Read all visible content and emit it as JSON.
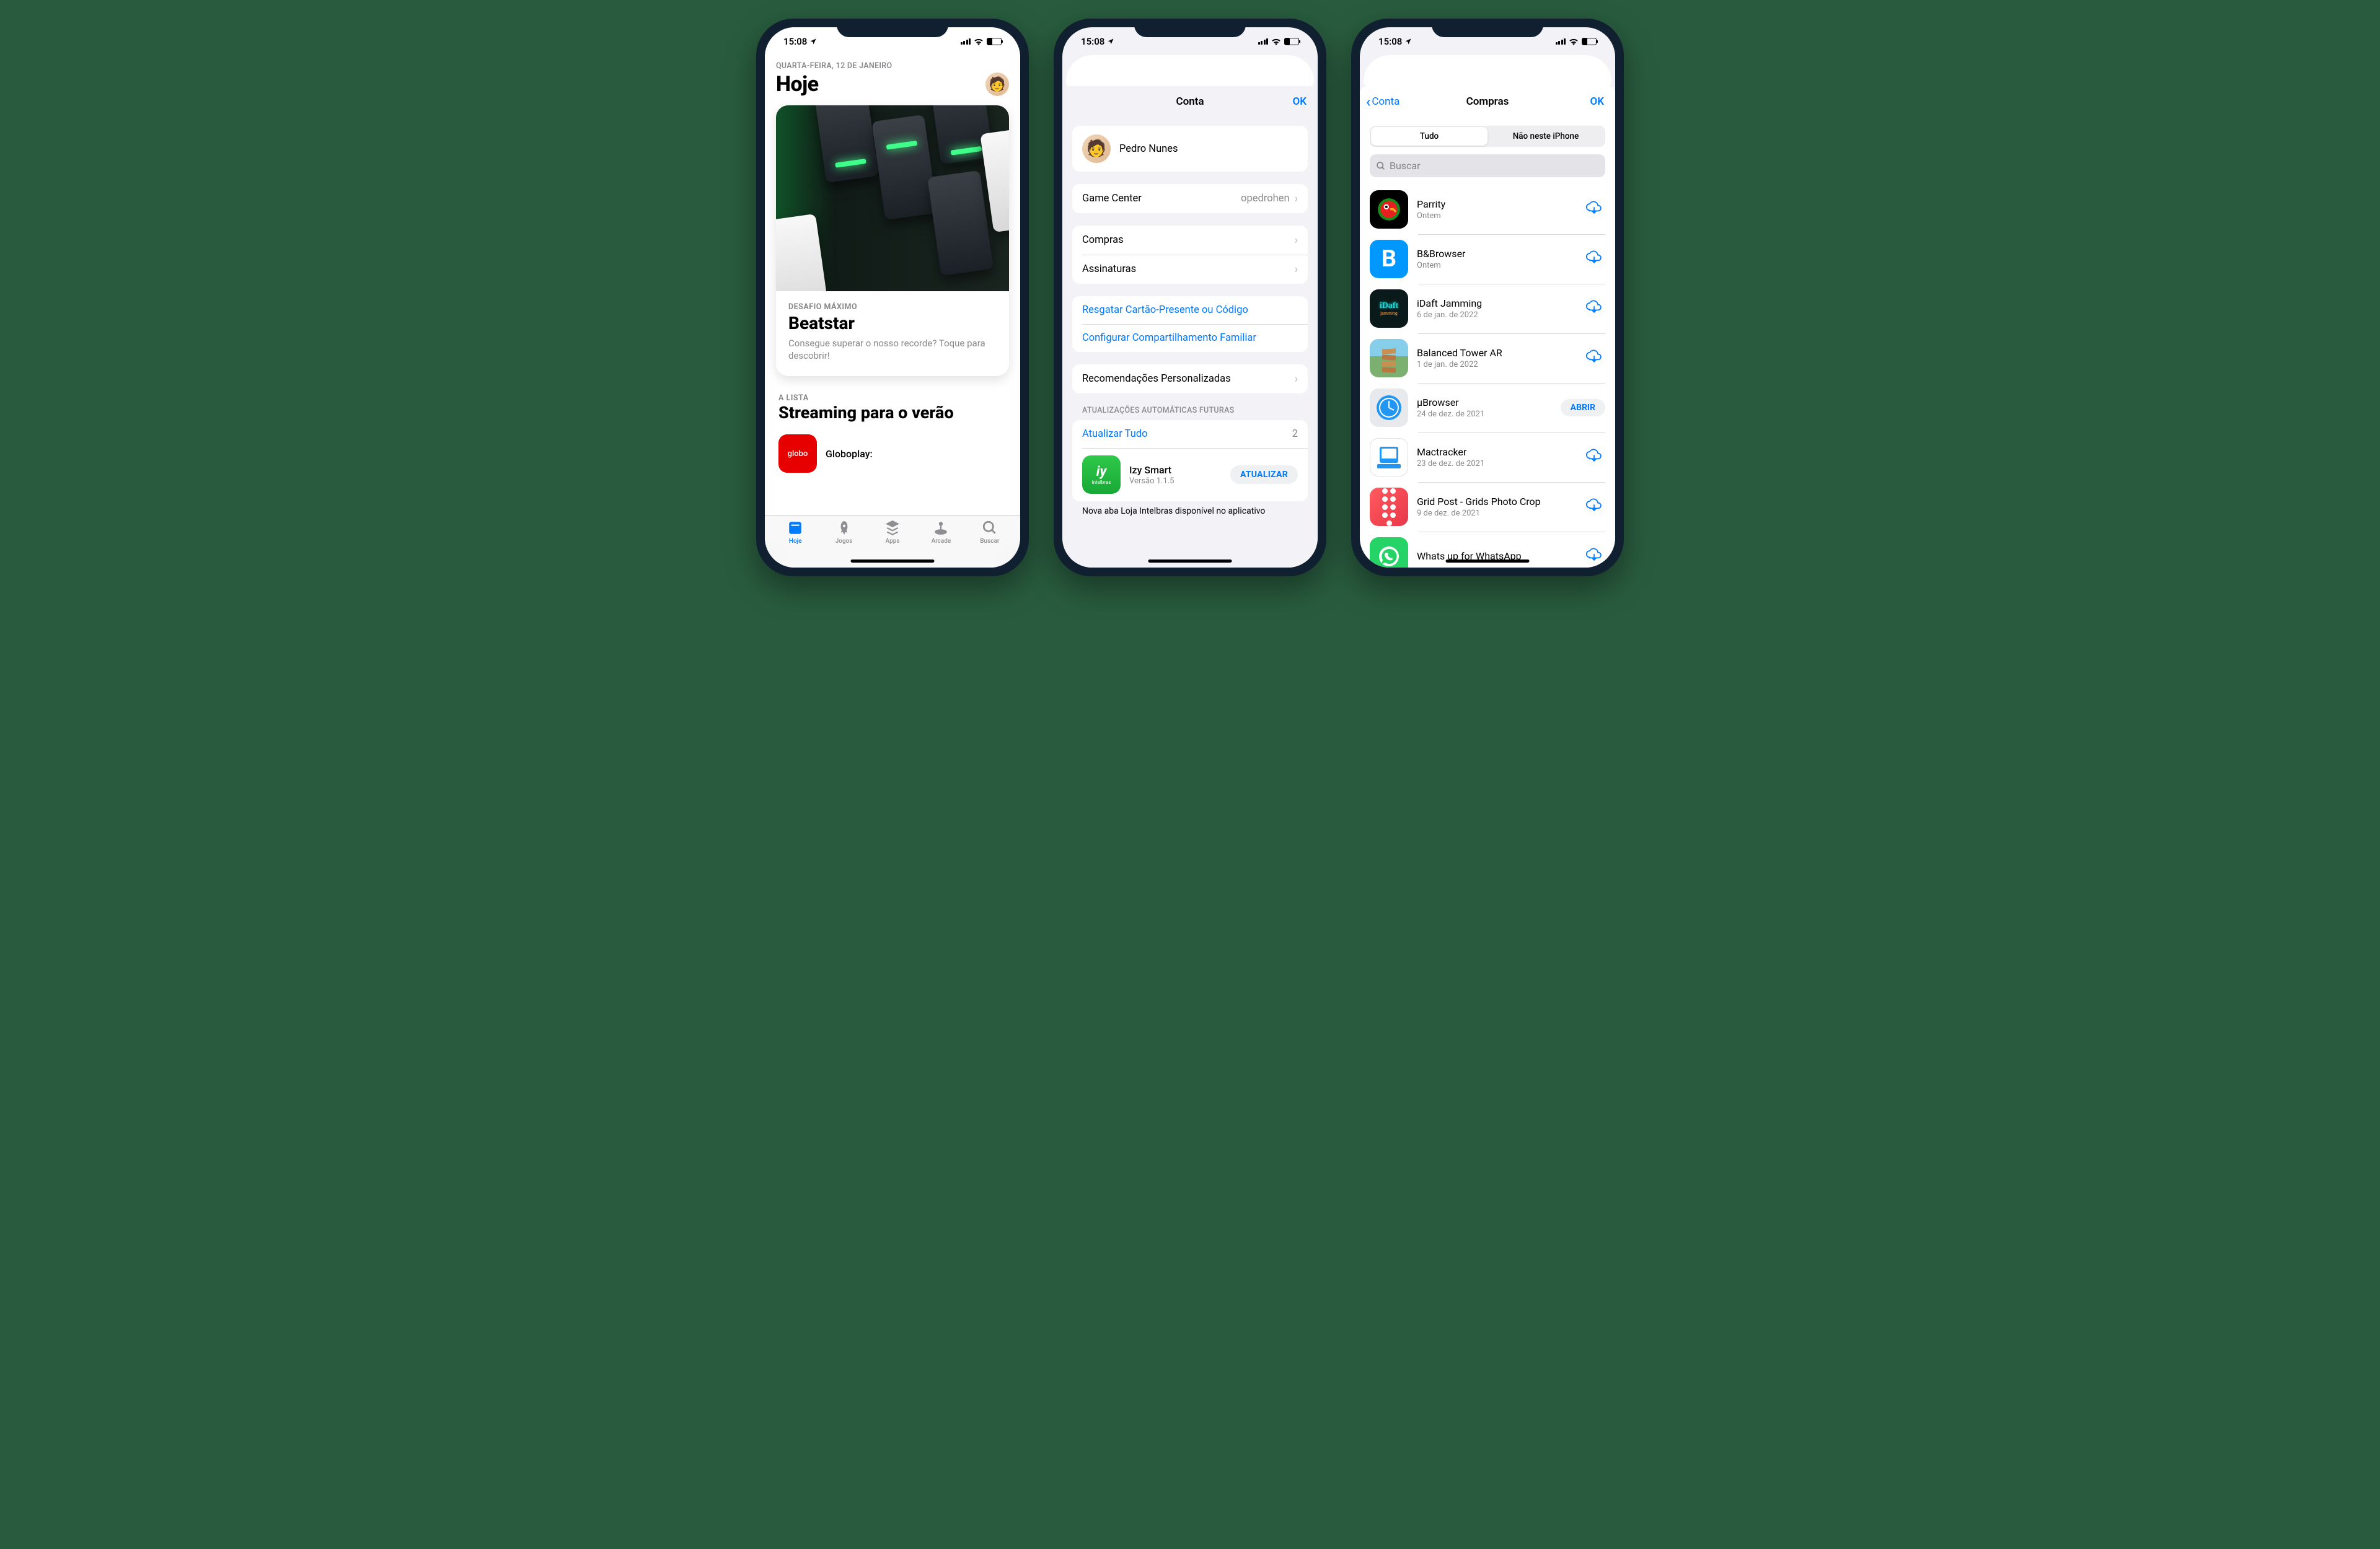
{
  "status": {
    "time": "15:08"
  },
  "screen1": {
    "date": "QUARTA-FEIRA, 12 DE JANEIRO",
    "title": "Hoje",
    "hero": {
      "eyebrow": "DESAFIO MÁXIMO",
      "name": "Beatstar",
      "desc": "Consegue superar o nosso recorde? Toque para descobrir!"
    },
    "list": {
      "eyebrow": "A LISTA",
      "title": "Streaming para o verão",
      "app": {
        "icon_label": "globo",
        "name": "Globoplay:"
      }
    },
    "tabs": {
      "hoje": "Hoje",
      "jogos": "Jogos",
      "apps": "Apps",
      "arcade": "Arcade",
      "buscar": "Buscar"
    }
  },
  "screen2": {
    "title": "Conta",
    "ok": "OK",
    "profile": {
      "name": "Pedro Nunes"
    },
    "game_center": {
      "label": "Game Center",
      "value": "opedrohen"
    },
    "compras": "Compras",
    "assinaturas": "Assinaturas",
    "resgatar": "Resgatar Cartão-Presente ou Código",
    "configurar": "Configurar Compartilhamento Familiar",
    "recomend": "Recomendações Personalizadas",
    "updates_caption": "ATUALIZAÇÕES AUTOMÁTICAS FUTURAS",
    "update_all": "Atualizar Tudo",
    "update_count": "2",
    "upd_app": {
      "name": "Izy Smart",
      "version": "Versão 1.1.5",
      "icon_main": "iy",
      "icon_sub": "intelbras",
      "button": "ATUALIZAR"
    },
    "upd_desc": "Nova aba Loja Intelbras disponível no aplicativo"
  },
  "screen3": {
    "back": "Conta",
    "title": "Compras",
    "ok": "OK",
    "seg": {
      "all": "Tudo",
      "not_here": "Não neste iPhone"
    },
    "search_placeholder": "Buscar",
    "open_label": "ABRIR",
    "apps": [
      {
        "name": "Parrity",
        "date": "Ontem",
        "action": "download",
        "icon": "parrity"
      },
      {
        "name": "B&Browser",
        "date": "Ontem",
        "action": "download",
        "icon": "bbrowser"
      },
      {
        "name": "iDaft Jamming",
        "date": "6 de jan. de 2022",
        "action": "download",
        "icon": "idaft"
      },
      {
        "name": "Balanced Tower AR",
        "date": "1 de jan. de 2022",
        "action": "download",
        "icon": "balanced"
      },
      {
        "name": "μBrowser",
        "date": "24 de dez. de 2021",
        "action": "open",
        "icon": "ubrowser"
      },
      {
        "name": "Mactracker",
        "date": "23 de dez. de 2021",
        "action": "download",
        "icon": "mactracker"
      },
      {
        "name": "Grid Post - Grids Photo Crop",
        "date": "9 de dez. de 2021",
        "action": "download",
        "icon": "gridpost"
      },
      {
        "name": "Whats up for WhatsApp",
        "date": "",
        "action": "download",
        "icon": "whatsup"
      }
    ]
  }
}
